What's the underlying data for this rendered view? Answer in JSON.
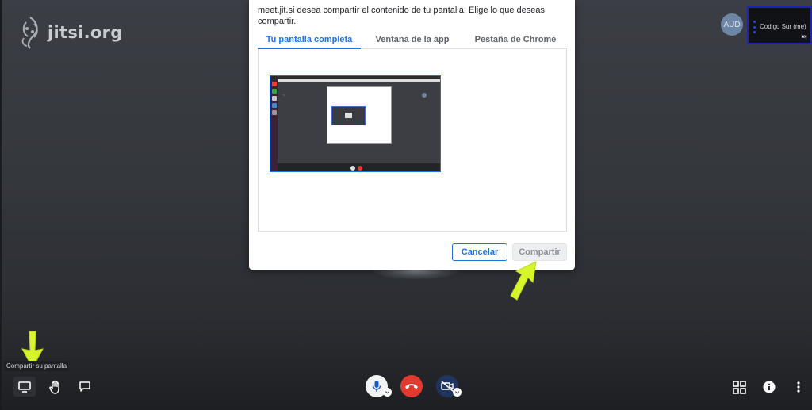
{
  "brand": {
    "logo_text": "jitsi.org"
  },
  "participants": {
    "remote_avatar": "AUD",
    "local_name": "Codigo Sur (me)"
  },
  "dialog": {
    "message": "meet.jit.si desea compartir el contenido de tu pantalla. Elige lo que deseas compartir.",
    "tabs": [
      {
        "label": "Tu pantalla completa",
        "active": true
      },
      {
        "label": "Ventana de la app",
        "active": false
      },
      {
        "label": "Pestaña de Chrome",
        "active": false
      }
    ],
    "cancel_label": "Cancelar",
    "share_label": "Compartir"
  },
  "toolbar": {
    "share_tooltip": "Compartir su pantalla",
    "left_icons": [
      "screen-share-icon",
      "raise-hand-icon",
      "chat-icon"
    ],
    "center_icons": [
      "microphone-icon",
      "hangup-icon",
      "camera-off-icon"
    ],
    "right_icons": [
      "tile-view-icon",
      "info-icon",
      "more-vertical-icon"
    ]
  },
  "colors": {
    "accent": "#1a73e8",
    "hangup": "#e23a2f",
    "annotation_arrow": "#d7f52a"
  }
}
